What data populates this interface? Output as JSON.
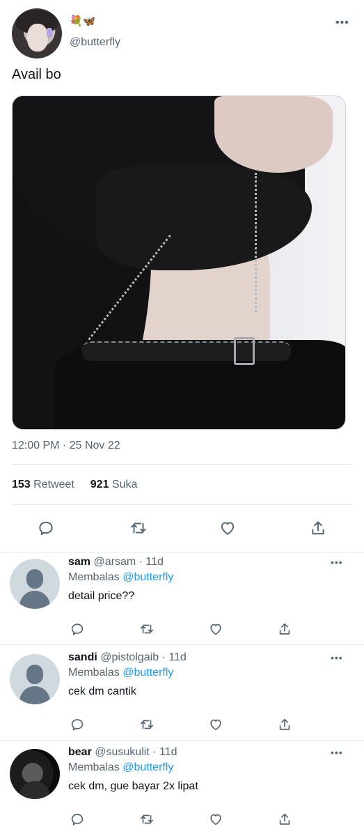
{
  "tweet": {
    "emoji": [
      "💐",
      "🦋"
    ],
    "handle": "@butterfly",
    "text": "Avail bo",
    "timestamp": "12:00 PM · 25 Nov 22",
    "retweet_count": "153",
    "retweet_label": "Retweet",
    "like_count": "921",
    "like_label": "Suka",
    "more": "•••"
  },
  "replies": [
    {
      "name": "sam",
      "meta": "@arsam · 11d",
      "replying_prefix": "Membalas ",
      "replying_to": "@butterfly",
      "text": "detail price??",
      "avatar": "default",
      "more": "•••"
    },
    {
      "name": "sandi",
      "meta": "@pistolgaib · 11d",
      "replying_prefix": "Membalas ",
      "replying_to": "@butterfly",
      "text": "cek dm cantik",
      "avatar": "default",
      "more": "•••"
    },
    {
      "name": "bear",
      "meta": "@susukulit · 11d",
      "replying_prefix": "Membalas ",
      "replying_to": "@butterfly",
      "text": "cek dm, gue bayar 2x lipat",
      "avatar": "photo",
      "more": "•••"
    }
  ],
  "icons": [
    "reply-icon",
    "retweet-icon",
    "like-icon",
    "share-icon",
    "more-icon"
  ],
  "colors": {
    "text": "#0f1419",
    "secondary": "#536471",
    "link": "#1d9bf0",
    "divider": "#e1e8ed"
  }
}
